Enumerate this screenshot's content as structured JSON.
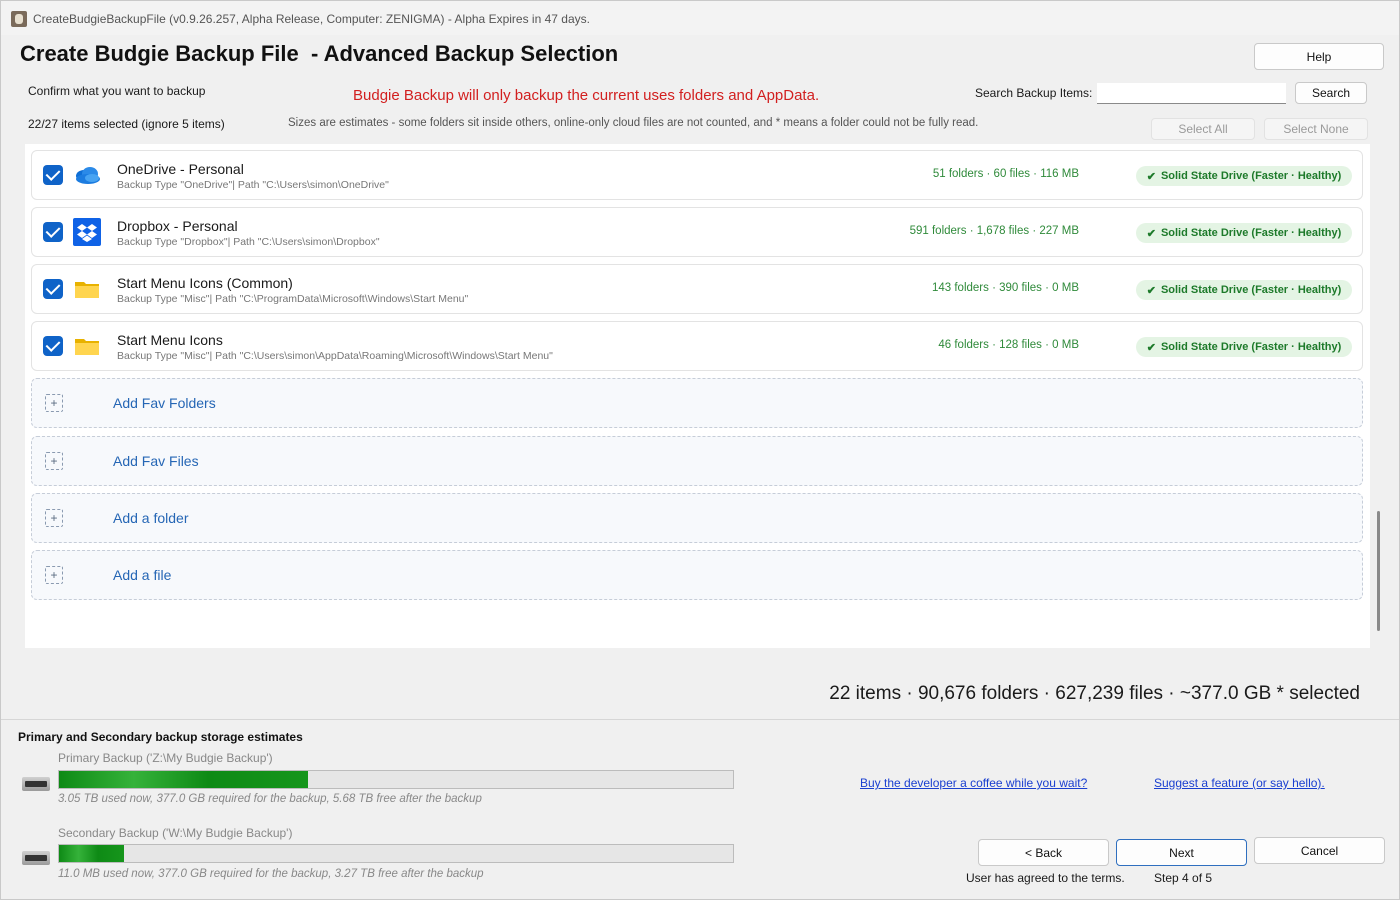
{
  "window": {
    "title": "CreateBudgieBackupFile (v0.9.26.257, Alpha Release, Computer: ZENIGMA) - Alpha Expires in 47 days."
  },
  "header": {
    "page_title": "Create Budgie Backup File  - Advanced Backup Selection",
    "help_label": "Help",
    "confirm_label": "Confirm what you want to backup",
    "notice": "Budgie Backup will only backup the current uses folders and AppData.",
    "search_label": "Search Backup Items:",
    "search_value": "",
    "search_button": "Search",
    "selected_count": "22/27 items selected (ignore 5 items)",
    "sizes_note": "Sizes are estimates - some folders sit inside others, online-only cloud files are not counted, and * means a folder could not be fully read.",
    "select_all": "Select All",
    "select_none": "Select None"
  },
  "items": [
    {
      "name": "OneDrive - Personal",
      "path": "Backup Type \"OneDrive\"| Path \"C:\\Users\\simon\\OneDrive\"",
      "stats": "51 folders · 60 files · 116 MB",
      "badge": "Solid State Drive (Faster · Healthy)",
      "checked": true,
      "icon": "onedrive-cloud-icon"
    },
    {
      "name": "Dropbox - Personal",
      "path": "Backup Type \"Dropbox\"| Path \"C:\\Users\\simon\\Dropbox\"",
      "stats": "591 folders · 1,678 files · 227 MB",
      "badge": "Solid State Drive (Faster · Healthy)",
      "checked": true,
      "icon": "dropbox-icon"
    },
    {
      "name": "Start Menu Icons (Common)",
      "path": "Backup Type \"Misc\"| Path \"C:\\ProgramData\\Microsoft\\Windows\\Start Menu\"",
      "stats": "143 folders · 390 files · 0 MB",
      "badge": "Solid State Drive (Faster · Healthy)",
      "checked": true,
      "icon": "folder-icon"
    },
    {
      "name": "Start Menu Icons",
      "path": "Backup Type \"Misc\"| Path \"C:\\Users\\simon\\AppData\\Roaming\\Microsoft\\Windows\\Start Menu\"",
      "stats": "46 folders · 128 files · 0 MB",
      "badge": "Solid State Drive (Faster · Healthy)",
      "checked": true,
      "icon": "folder-icon"
    }
  ],
  "add_rows": [
    {
      "label": "Add Fav Folders"
    },
    {
      "label": "Add Fav Files"
    },
    {
      "label": "Add a folder"
    },
    {
      "label": "Add a file"
    }
  ],
  "totals": "22 items · 90,676 folders · 627,239 files · ~377.0 GB * selected",
  "storage": {
    "heading": "Primary and Secondary backup storage estimates",
    "primary": {
      "label": "Primary Backup ('Z:\\My Budgie Backup')",
      "note": "3.05 TB used now, 377.0 GB required for the backup, 5.68 TB free after the backup",
      "fill_fraction": 0.37
    },
    "secondary": {
      "label": "Secondary Backup ('W:\\My Budgie Backup')",
      "note": "11.0 MB used now, 377.0 GB required for the backup, 3.27 TB free after the backup",
      "fill_fraction": 0.097
    }
  },
  "links": {
    "coffee": "Buy the developer a coffee while you wait?",
    "suggest": "Suggest a feature (or say hello)."
  },
  "footer": {
    "back": "< Back",
    "next": "Next",
    "cancel": "Cancel",
    "terms": "User has agreed to the terms.",
    "step": "Step 4 of 5"
  },
  "colors": {
    "accent": "#0f63c8",
    "notice_red": "#d21f1f",
    "stats_green": "#2f8a3a",
    "badge_bg": "#e4f4e4",
    "bar_green": "#16961c",
    "link_blue": "#1a3fd0"
  }
}
